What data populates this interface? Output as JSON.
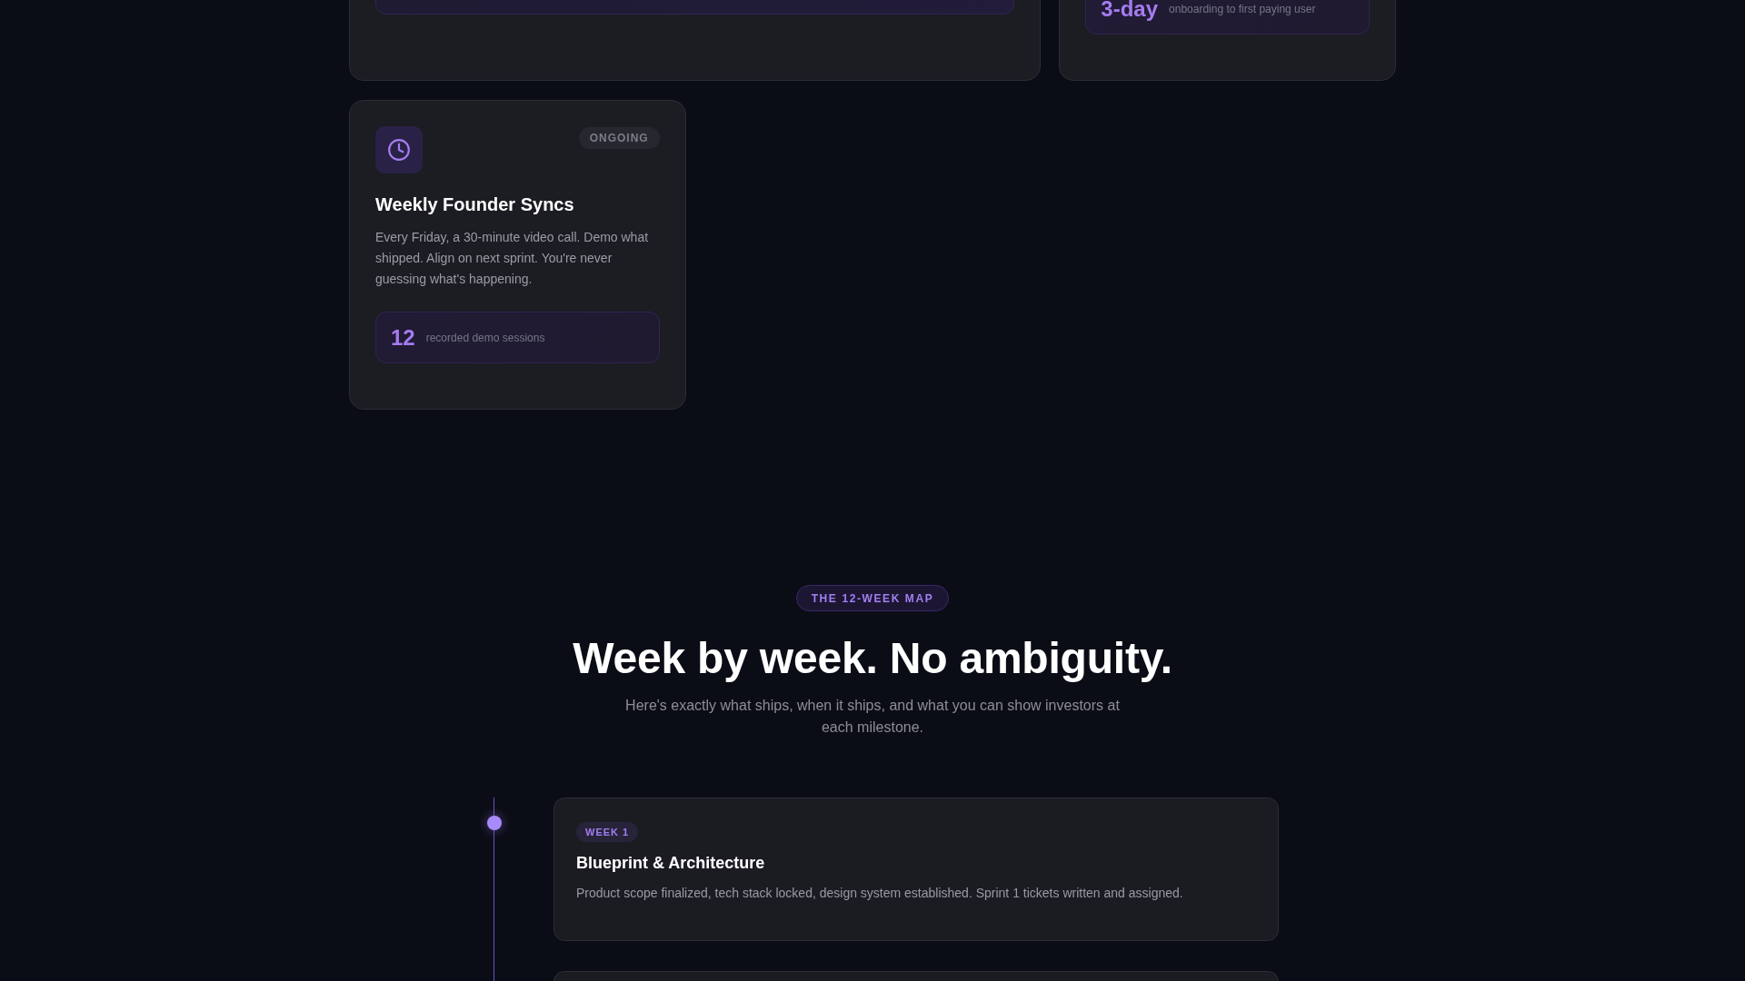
{
  "upper_cards": [
    {
      "kind": "panel"
    },
    {
      "kind": "stat",
      "stat": {
        "value": "3-day",
        "label": "onboarding to first paying user"
      }
    }
  ],
  "cards": [
    {
      "status": "ONGOING",
      "title": "Weekly Founder Syncs",
      "description": "Every Friday, a 30-minute video call. Demo what shipped. Align on next sprint. You're never guessing what's happening.",
      "stat": {
        "value": "12",
        "label": "recorded demo sessions"
      }
    }
  ],
  "roadmap": {
    "eyebrow": "THE 12-WEEK MAP",
    "heading": "Week by week. No ambiguity.",
    "subheading": "Here's exactly what ships, when it ships, and what you can show investors at each milestone.",
    "milestones": [
      {
        "kind": "full",
        "week": "WEEK 1",
        "title": "Blueprint & Architecture",
        "description": "Product scope finalized, tech stack locked, design system established. Sprint 1 tickets written and assigned."
      },
      {
        "kind": "edge"
      }
    ]
  }
}
